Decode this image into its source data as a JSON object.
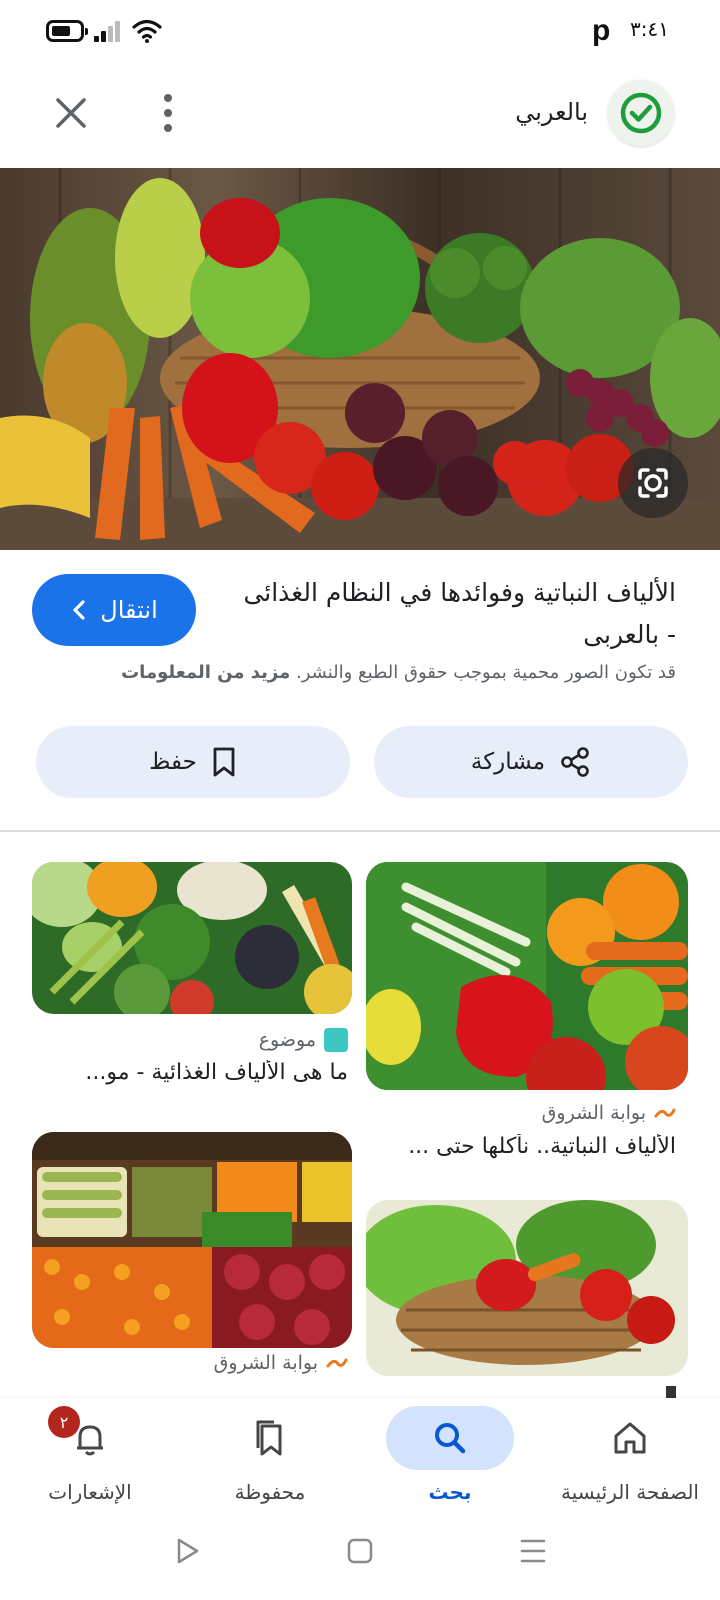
{
  "status_bar": {
    "time": "٣:٤١",
    "carrier_icon": "p-icon",
    "icons": [
      "battery-icon",
      "signal-icon",
      "wifi-icon"
    ]
  },
  "header": {
    "source_name": "بالعربي",
    "source_icon": "check-circle-icon",
    "more_icon": "more-vert-icon",
    "close_icon": "close-icon"
  },
  "hero": {
    "image_description_icon": "vegetable-basket-photo",
    "lens_icon": "lens-icon"
  },
  "result": {
    "title": "الألياف النباتية وفوائدها في النظام الغذائى - بالعربى",
    "visit_label": "انتقال",
    "copyright_text": "قد تكون الصور محمية بموجب حقوق الطبع والنشر.",
    "more_info_label": "مزيد من المعلومات",
    "share_label": "مشاركة",
    "save_label": "حفظ"
  },
  "related": [
    {
      "source": "بوابة الشروق",
      "title": "الألياف النباتية.. نأكلها حتى ..."
    },
    {
      "source": "موضوع",
      "title": "ما هى الألياف الغذائية - مو..."
    },
    {
      "source": "بوابة الشروق",
      "title": ""
    },
    {
      "source": "",
      "title": ""
    }
  ],
  "bottom_nav": {
    "items": [
      {
        "label": "الصفحة الرئيسية",
        "icon": "home-icon"
      },
      {
        "label": "بحث",
        "icon": "search-icon"
      },
      {
        "label": "محفوظة",
        "icon": "bookmarks-icon"
      },
      {
        "label": "الإشعارات",
        "icon": "bell-icon",
        "badge": "٢"
      }
    ],
    "active": "بحث"
  },
  "colors": {
    "accent": "#1a73e8",
    "pill_bg": "#e8eef9",
    "nav_active_bg": "#d3e3fd",
    "badge": "#b3261e"
  }
}
